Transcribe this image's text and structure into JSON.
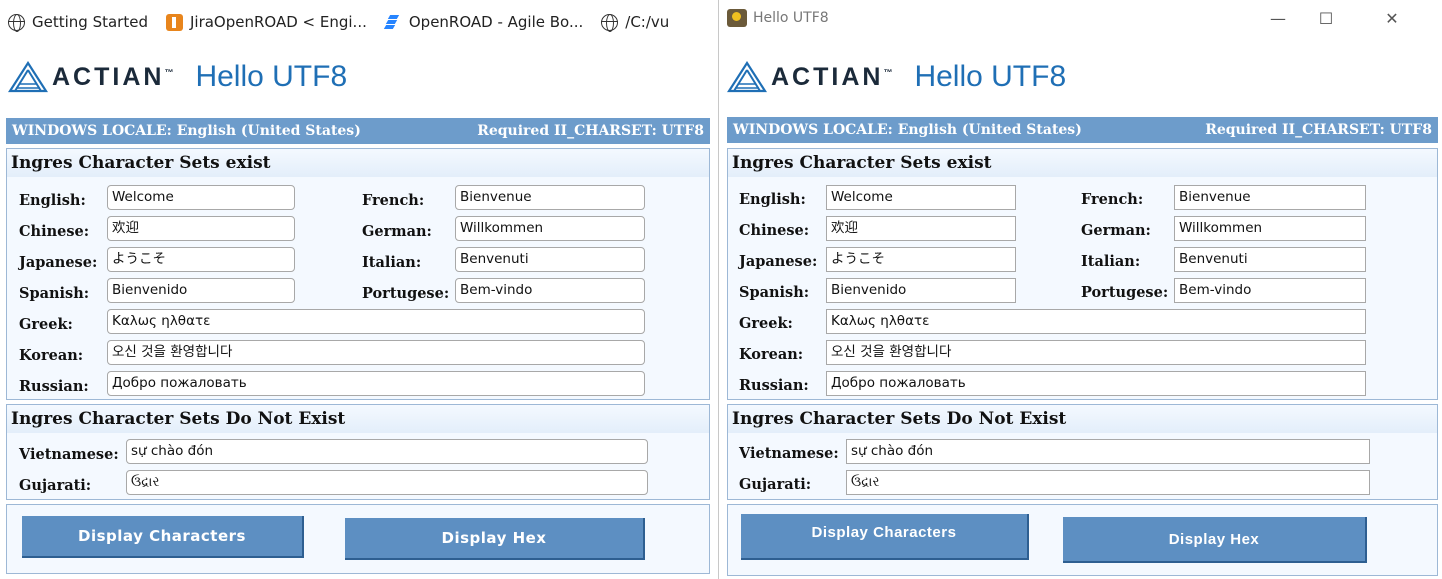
{
  "bookmarks": [
    {
      "icon": "globe-icon",
      "label": "Getting Started"
    },
    {
      "icon": "jira-icon",
      "label": "JiraOpenROAD < Engi..."
    },
    {
      "icon": "agile-board-icon",
      "label": "OpenROAD - Agile Bo..."
    },
    {
      "icon": "globe-icon",
      "label": "/C:/vu"
    }
  ],
  "window": {
    "title": "Hello UTF8",
    "minimize": "—",
    "maximize": "☐",
    "close": "✕"
  },
  "app": {
    "logo_text": "ACTIAN",
    "logo_tm": "™",
    "title": "Hello UTF8",
    "locale_label": "WINDOWS LOCALE: English (United States)",
    "charset_label": "Required II_CHARSET: UTF8",
    "exist_title": "Ingres Character Sets exist",
    "not_exist_title": "Ingres Character Sets Do Not Exist",
    "fields": {
      "english": {
        "label": "English:",
        "value": "Welcome"
      },
      "french": {
        "label": "French:",
        "value": "Bienvenue"
      },
      "chinese": {
        "label": "Chinese:",
        "value": "欢迎"
      },
      "german": {
        "label": "German:",
        "value": "Willkommen"
      },
      "japanese": {
        "label": "Japanese:",
        "value": "ようこそ"
      },
      "italian": {
        "label": "Italian:",
        "value": "Benvenuti"
      },
      "spanish": {
        "label": "Spanish:",
        "value": "Bienvenido"
      },
      "portugese": {
        "label": "Portugese:",
        "value": "Bem-vindo"
      },
      "greek": {
        "label": "Greek:",
        "value": "Καλως ηλθατε"
      },
      "korean": {
        "label": "Korean:",
        "value": "오신 것을 환영합니다"
      },
      "russian": {
        "label": "Russian:",
        "value": "Добро пожаловать"
      },
      "vietnamese": {
        "label": "Vietnamese:",
        "value": "sự chào đón"
      },
      "gujarati": {
        "label": "Gujarati:",
        "value": "ઉદ્રાર"
      }
    },
    "buttons": {
      "display_characters": "Display Characters",
      "display_hex": "Display Hex"
    }
  },
  "colors": {
    "accent": "#6d9ccb",
    "title_blue": "#1f6fb5",
    "button": "#5d8fc2"
  }
}
